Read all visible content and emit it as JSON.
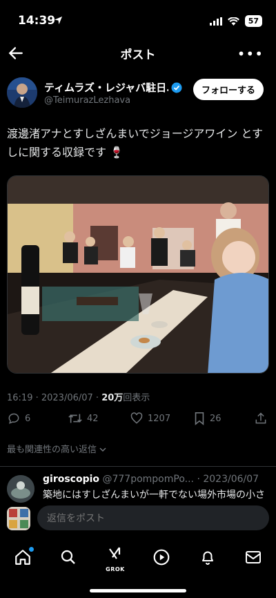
{
  "status": {
    "time": "14:39",
    "battery": "57"
  },
  "header": {
    "title": "ポスト"
  },
  "author": {
    "name": "ティムラズ・レジャバ駐日…",
    "handle": "@TeimurazLezhava",
    "follow_label": "フォローする"
  },
  "post": {
    "text": "渡邊渚アナとすしざんまいでジョージアワイン とすしに関する収録です 🍷",
    "timestamp": "16:19 · 2023/06/07 · ",
    "views_count": "20万",
    "views_label": "回表示"
  },
  "actions": {
    "replies": "6",
    "reposts": "42",
    "likes": "1207",
    "bookmarks": "26"
  },
  "relevance_label": "最も関連性の高い返信",
  "reply": {
    "name": "giroscopio",
    "handle_date": "@777pompomPo... · 2023/06/07",
    "text": "築地にはすしざんまいが一軒でない場外市場の小さ"
  },
  "composer": {
    "placeholder": "返信をポスト"
  },
  "tabbar": {
    "grok_label": "GROK"
  },
  "colors": {
    "accent": "#1d9bf0",
    "background": "#000000",
    "muted": "#71767b"
  }
}
